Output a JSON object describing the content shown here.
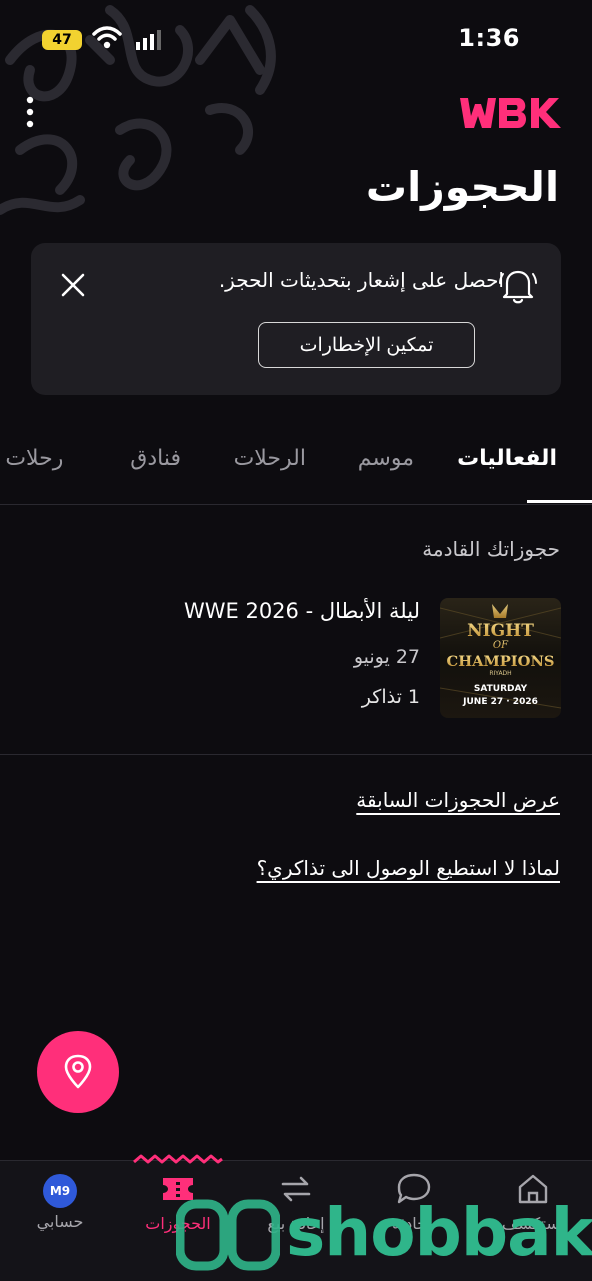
{
  "status_bar": {
    "time": "1:36",
    "battery": "47"
  },
  "header": {
    "logo": "WBK",
    "title": "الحجوزات"
  },
  "notification": {
    "text": "احصل على إشعار بتحديثات الحجز.",
    "button_label": "تمكين الإخطارات"
  },
  "tabs": [
    {
      "label": "الفعاليات",
      "active": true
    },
    {
      "label": "موسم",
      "active": false
    },
    {
      "label": "الرحلات",
      "active": false
    },
    {
      "label": "فنادق",
      "active": false
    },
    {
      "label": "رحلات ط",
      "active": false
    }
  ],
  "upcoming": {
    "section_title": "حجوزاتك القادمة",
    "booking": {
      "title": "ليلة الأبطال - WWE 2026",
      "date": "27 يونيو",
      "tickets": "1 تذاكر",
      "poster": {
        "line1": "NIGHT",
        "line2": "OF",
        "line3": "CHAMPIONS",
        "line4": "RIYADH",
        "line5": "SATURDAY",
        "line6": "JUNE 27 · 2026"
      }
    }
  },
  "links": {
    "past_bookings": "عرض الحجوزات السابقة",
    "cant_access": "لماذا لا استطيع الوصول الى تذاكري؟"
  },
  "bottom_nav": {
    "items": [
      {
        "label": "استكشف",
        "icon": "home-icon"
      },
      {
        "label": "محادثة",
        "icon": "chat-icon"
      },
      {
        "label": "إعادة بيع",
        "icon": "resale-icon"
      },
      {
        "label": "الحجوزات",
        "icon": "ticket-icon",
        "active": true
      },
      {
        "label": "حسابي",
        "icon": "avatar",
        "initials": "M9"
      }
    ]
  },
  "watermark": "shobbak",
  "colors": {
    "accent": "#ff2f7a",
    "background": "#0d0c10",
    "card": "#1f1e23",
    "watermark": "#2fb58a"
  }
}
